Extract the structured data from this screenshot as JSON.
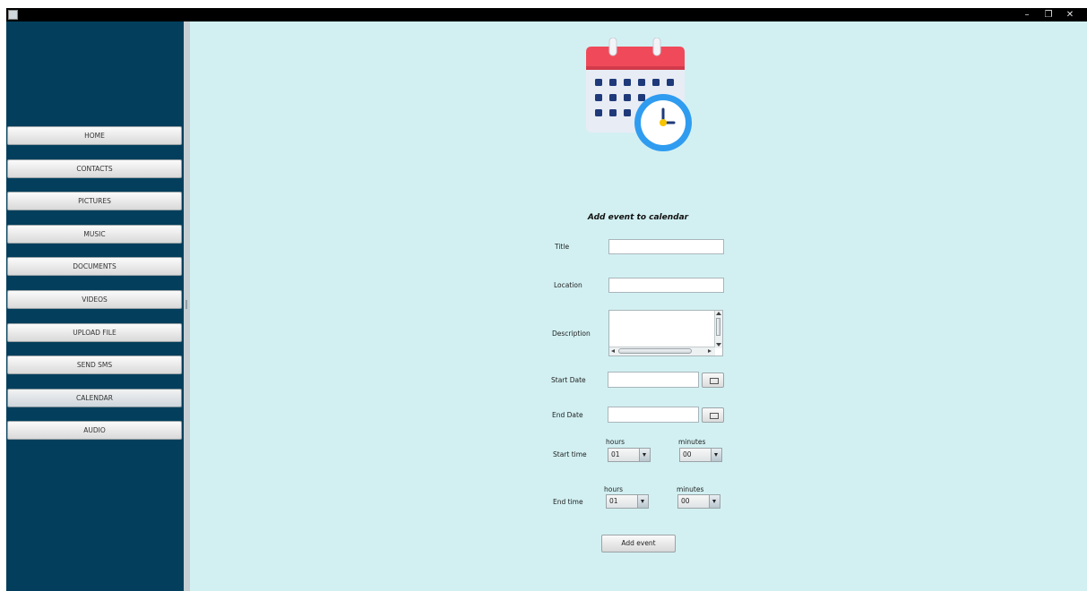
{
  "window": {
    "controls": {
      "minimize": "–",
      "maximize": "❐",
      "close": "✕"
    }
  },
  "sidebar": {
    "items": [
      {
        "label": "HOME"
      },
      {
        "label": "CONTACTS"
      },
      {
        "label": "PICTURES"
      },
      {
        "label": "MUSIC"
      },
      {
        "label": "DOCUMENTS"
      },
      {
        "label": "VIDEOS"
      },
      {
        "label": "UPLOAD FILE"
      },
      {
        "label": "SEND SMS"
      },
      {
        "label": "CALENDAR",
        "active": true
      },
      {
        "label": "AUDIO"
      }
    ]
  },
  "form": {
    "title": "Add event to calendar",
    "title_label": "Title",
    "title_value": "",
    "location_label": "Location",
    "location_value": "",
    "description_label": "Description",
    "description_value": "",
    "start_date_label": "Start Date",
    "start_date_value": "",
    "end_date_label": "End Date",
    "end_date_value": "",
    "start_time_label": "Start time",
    "end_time_label": "End time",
    "hours_label": "hours",
    "minutes_label": "minutes",
    "start_hours": "01",
    "start_minutes": "00",
    "end_hours": "01",
    "end_minutes": "00",
    "submit_label": "Add event"
  },
  "icons": {
    "app": "app-window-icon",
    "calendar": "calendar-clock-icon",
    "date_picker": "calendar-picker-icon"
  },
  "colors": {
    "sidebar_bg": "#033f5c",
    "main_bg": "#d2f0f2",
    "calendar_red": "#f04a5a",
    "clock_blue": "#2f9cf0"
  }
}
